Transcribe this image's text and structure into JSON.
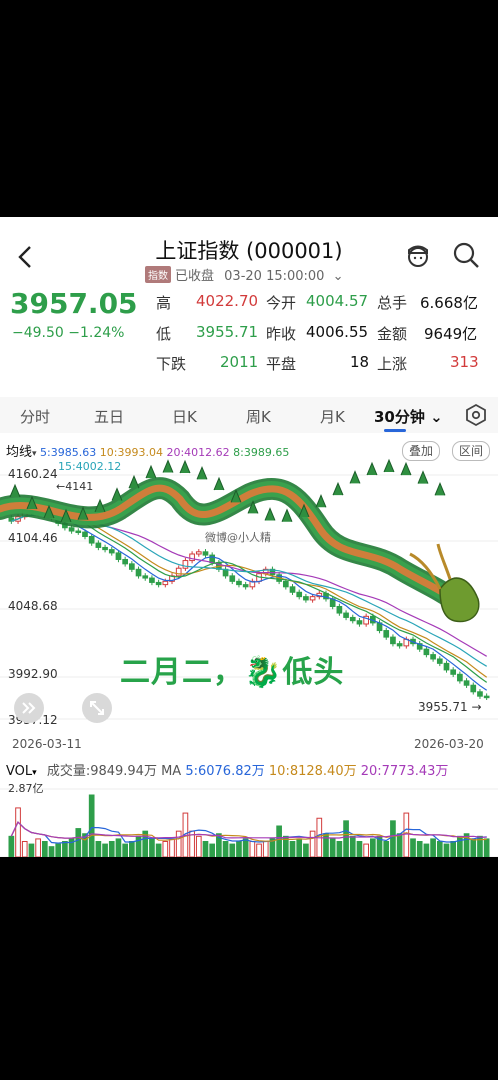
{
  "header": {
    "title": "上证指数 (000001)",
    "tag": "指数",
    "status": "已收盘",
    "datetime": "03-20 15:00:00"
  },
  "quote": {
    "price": "3957.05",
    "change": "−49.50 −1.24%",
    "stats": [
      {
        "label": "高",
        "value": "4022.70"
      },
      {
        "label": "今开",
        "value": "4004.57"
      },
      {
        "label": "总手",
        "value": "6.668亿"
      },
      {
        "label": "低",
        "value": "3955.71"
      },
      {
        "label": "昨收",
        "value": "4006.55"
      },
      {
        "label": "金额",
        "value": "9649亿"
      },
      {
        "label": "下跌",
        "value": "2011"
      },
      {
        "label": "平盘",
        "value": "18"
      },
      {
        "label": "上涨",
        "value": "313"
      }
    ]
  },
  "tabs": [
    "分时",
    "五日",
    "日K",
    "周K",
    "月K",
    "30分钟"
  ],
  "active_tab": "30分钟",
  "ma": {
    "label": "均线",
    "ma5": "5:3985.63",
    "ma10": "10:3993.04",
    "ma20": "20:4012.62",
    "ma8": "8:3989.65",
    "ma15": "15:4002.12"
  },
  "buttons": {
    "overlay": "叠加",
    "interval": "区间"
  },
  "price_axis": [
    "4160.24",
    "4104.46",
    "4048.68",
    "3992.90",
    "3937.12"
  ],
  "high_marker": "4141",
  "last_marker": "3955.71",
  "dates": {
    "start": "2026-03-11",
    "end": "2026-03-20"
  },
  "overlay_text": "二月二，🐉低头",
  "watermark": "微博@小人精",
  "volume": {
    "label": "VOL",
    "total": "成交量:9849.94万",
    "ma_label": "MA",
    "ma5": "5:6076.82万",
    "ma10": "10:8128.40万",
    "ma20": "20:7773.43万",
    "axis_top": "2.87亿"
  },
  "colors": {
    "up": "#d23b3b",
    "down": "#2e9e4a",
    "ma5": "#2866d9",
    "ma10": "#c58a1d",
    "ma20": "#a53bb8",
    "ma8": "#2e9e4a",
    "ma15": "#2aa5b8"
  },
  "chart_data": {
    "type": "candlestick",
    "ylim": [
      3937.12,
      4160.24
    ],
    "closes": [
      4118,
      4122,
      4128,
      4125,
      4130,
      4127,
      4121,
      4116,
      4112,
      4109,
      4108,
      4104,
      4098,
      4094,
      4092,
      4089,
      4083,
      4079,
      4074,
      4068,
      4066,
      4062,
      4060,
      4063,
      4068,
      4075,
      4082,
      4088,
      4090,
      4087,
      4080,
      4074,
      4068,
      4063,
      4060,
      4058,
      4063,
      4070,
      4074,
      4069,
      4063,
      4058,
      4053,
      4049,
      4046,
      4049,
      4052,
      4047,
      4040,
      4034,
      4030,
      4027,
      4024,
      4031,
      4025,
      4018,
      4012,
      4006,
      4004,
      4010,
      4006,
      4001,
      3996,
      3992,
      3988,
      3982,
      3978,
      3972,
      3968,
      3962,
      3958,
      3957
    ],
    "volumes": [
      0.8,
      1.9,
      0.6,
      0.5,
      0.7,
      0.6,
      0.4,
      0.5,
      0.6,
      0.7,
      1.1,
      0.9,
      2.4,
      0.6,
      0.5,
      0.6,
      0.7,
      0.5,
      0.6,
      0.8,
      1.0,
      0.7,
      0.5,
      0.6,
      0.7,
      1.0,
      1.7,
      1.0,
      0.8,
      0.6,
      0.5,
      0.9,
      0.6,
      0.5,
      0.6,
      0.7,
      0.6,
      0.5,
      0.6,
      0.7,
      1.2,
      0.8,
      0.6,
      0.7,
      0.5,
      1.0,
      1.5,
      0.9,
      0.7,
      0.6,
      1.4,
      0.8,
      0.6,
      0.5,
      0.7,
      0.8,
      0.6,
      1.4,
      0.9,
      1.7,
      0.7,
      0.6,
      0.5,
      0.7,
      0.6,
      0.5,
      0.6,
      0.8,
      0.9,
      0.7,
      0.8,
      0.7
    ]
  }
}
